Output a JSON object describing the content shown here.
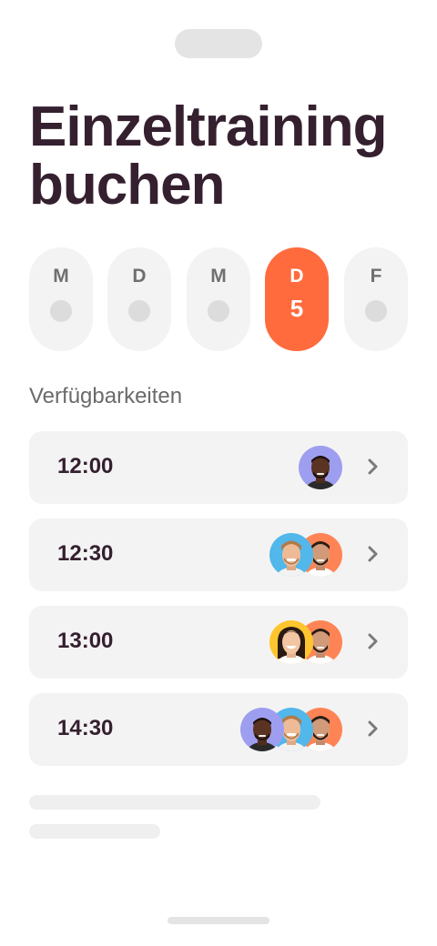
{
  "page": {
    "title": "Einzeltraining buchen"
  },
  "days": [
    {
      "letter": "M",
      "number": "",
      "selected": false
    },
    {
      "letter": "D",
      "number": "",
      "selected": false
    },
    {
      "letter": "M",
      "number": "",
      "selected": false
    },
    {
      "letter": "D",
      "number": "5",
      "selected": true
    },
    {
      "letter": "F",
      "number": "",
      "selected": false
    }
  ],
  "availability": {
    "label": "Verfügbarkeiten",
    "slots": [
      {
        "time": "12:00",
        "trainers": [
          "trainer-dark-beard"
        ]
      },
      {
        "time": "12:30",
        "trainers": [
          "trainer-blond-beard",
          "trainer-dark-beard-orange"
        ]
      },
      {
        "time": "13:00",
        "trainers": [
          "trainer-woman-blonde",
          "trainer-dark-beard-orange"
        ]
      },
      {
        "time": "14:30",
        "trainers": [
          "trainer-dark-beard",
          "trainer-blond-beard",
          "trainer-dark-beard-orange"
        ]
      }
    ]
  },
  "icons": {
    "chevron": "chevron-right-icon"
  },
  "colors": {
    "accent": "#ff6b3d",
    "title": "#35202f",
    "avatar_bg_purple": "#9e9ef0",
    "avatar_bg_blue": "#52b7ea",
    "avatar_bg_orange": "#ff8455",
    "avatar_bg_yellow": "#ffc52e"
  }
}
